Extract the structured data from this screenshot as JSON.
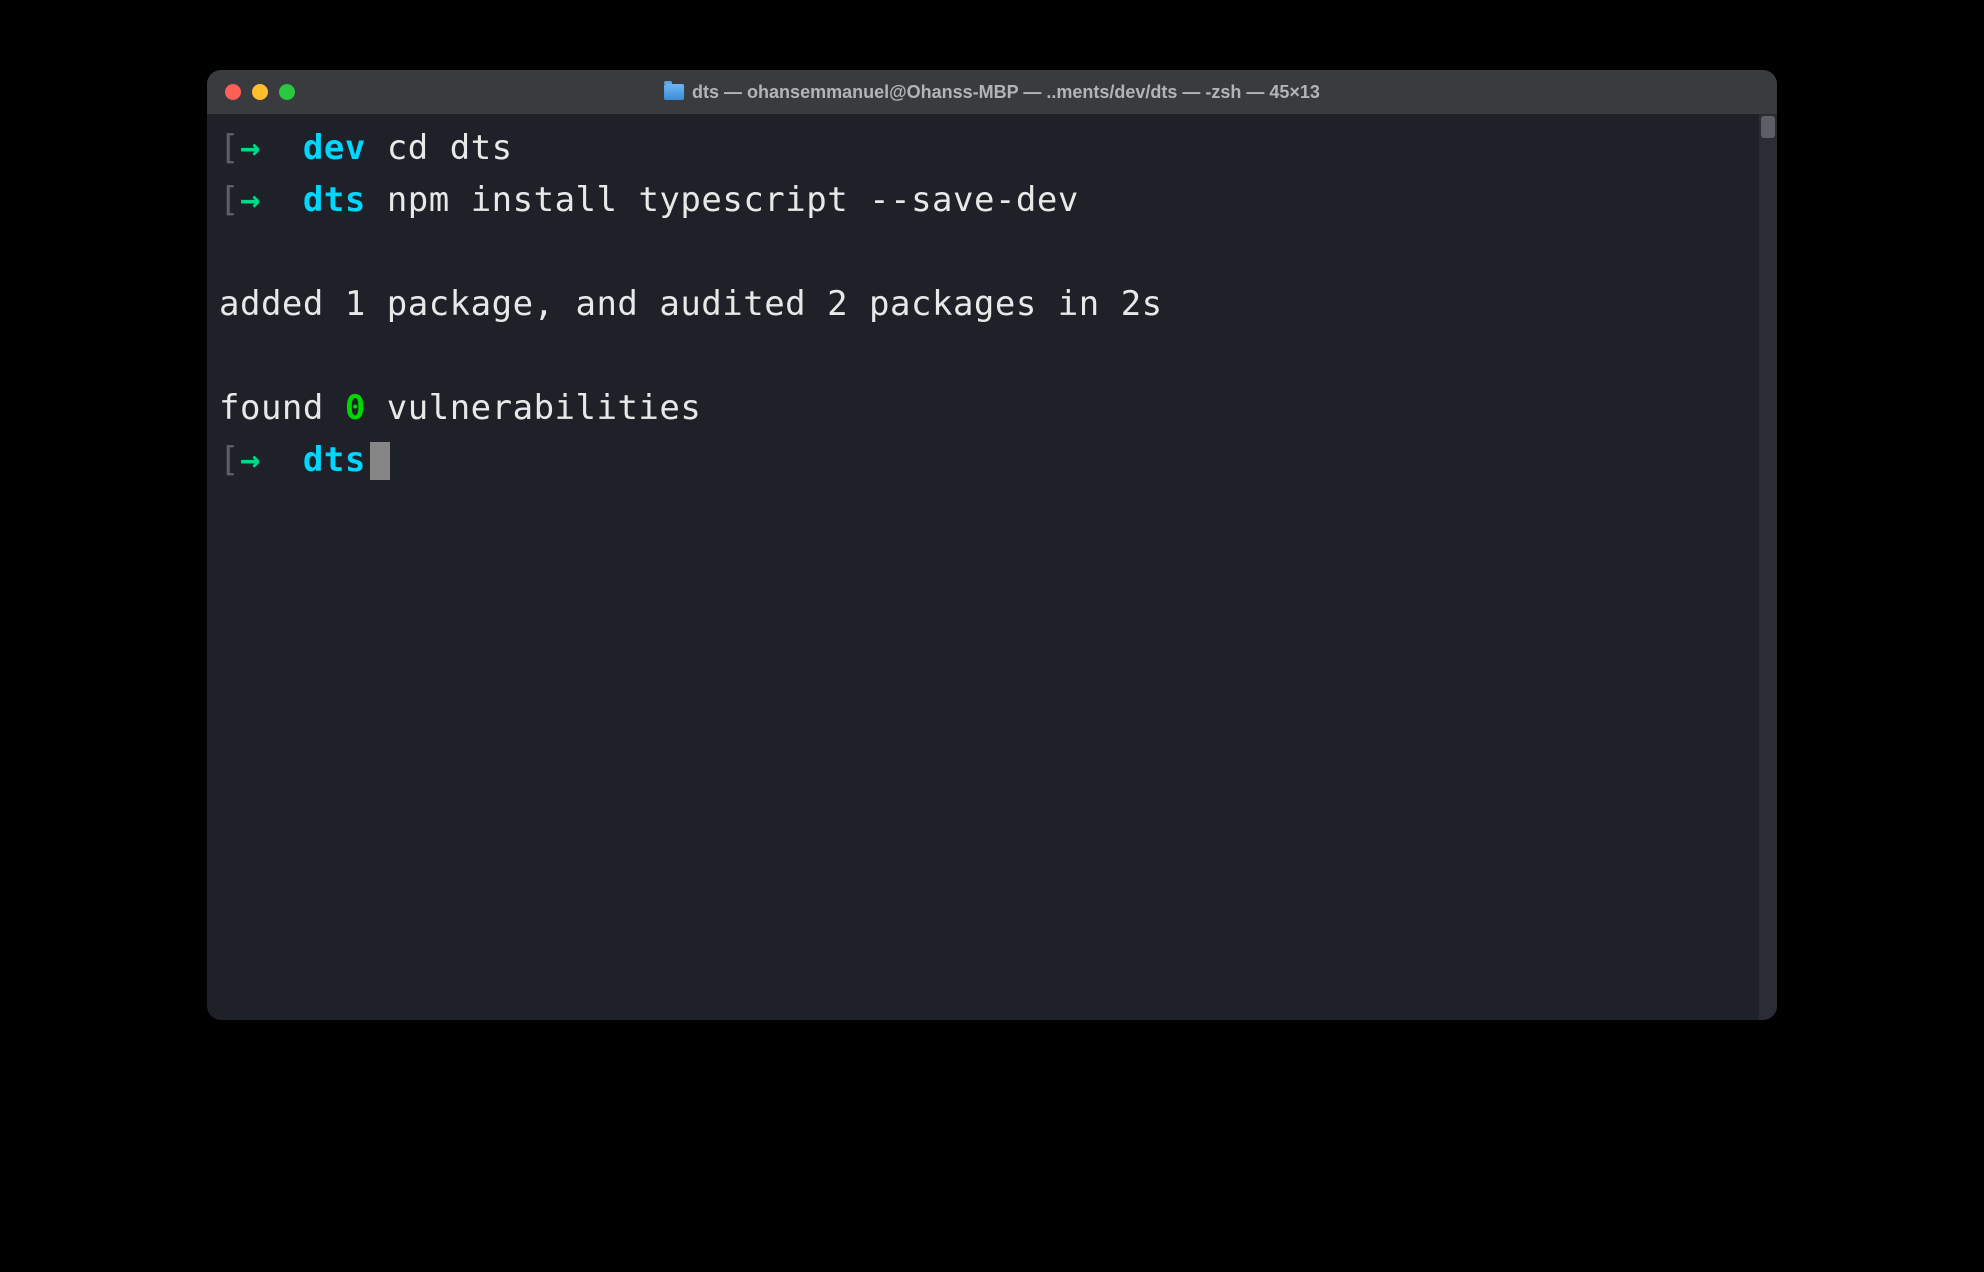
{
  "titlebar": {
    "folder_icon": "folder",
    "title": "dts — ohansemmanuel@Ohanss-MBP — ..ments/dev/dts — -zsh — 45×13"
  },
  "terminal": {
    "lines": [
      {
        "type": "prompt",
        "bracket_open": "[",
        "arrow": "→",
        "dir": "dev",
        "command": "cd dts",
        "bracket_close": "]"
      },
      {
        "type": "prompt",
        "bracket_open": "[",
        "arrow": "→",
        "dir": "dts",
        "command": "npm install typescript --save-dev",
        "bracket_close": "]"
      },
      {
        "type": "blank"
      },
      {
        "type": "output",
        "text": "added 1 package, and audited 2 packages in 2s"
      },
      {
        "type": "blank"
      },
      {
        "type": "output-vuln",
        "prefix": "found ",
        "count": "0",
        "suffix": " vulnerabilities"
      },
      {
        "type": "prompt-cursor",
        "bracket_open": "[",
        "arrow": "→",
        "dir": "dts"
      }
    ]
  }
}
